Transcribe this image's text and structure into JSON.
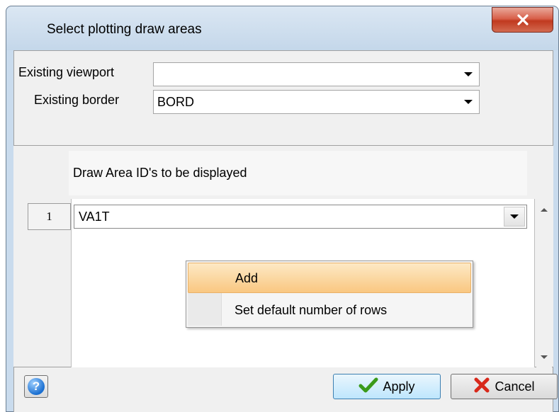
{
  "window": {
    "title": "Select plotting draw areas"
  },
  "form": {
    "viewport_label": "Existing viewport",
    "viewport_value": "",
    "border_label": "Existing border",
    "border_value": "BORD"
  },
  "grid": {
    "header": "Draw Area ID's to be displayed",
    "rows": [
      {
        "number": "1",
        "value": "VA1T"
      }
    ]
  },
  "context_menu": {
    "items": [
      {
        "label": "Add"
      },
      {
        "label": "Set default number of rows"
      }
    ]
  },
  "footer": {
    "apply_label": "Apply",
    "cancel_label": "Cancel"
  },
  "icons": {
    "close": "close-icon",
    "help": "help-icon",
    "apply": "checkmark-icon",
    "cancel": "cross-icon",
    "dropdown": "chevron-down-icon"
  },
  "colors": {
    "close_button": "#c0391f",
    "menu_highlight": "#f9c781",
    "apply_border": "#3c7fb1",
    "apply_check": "#3a9a1a",
    "cancel_cross": "#d8291b"
  }
}
